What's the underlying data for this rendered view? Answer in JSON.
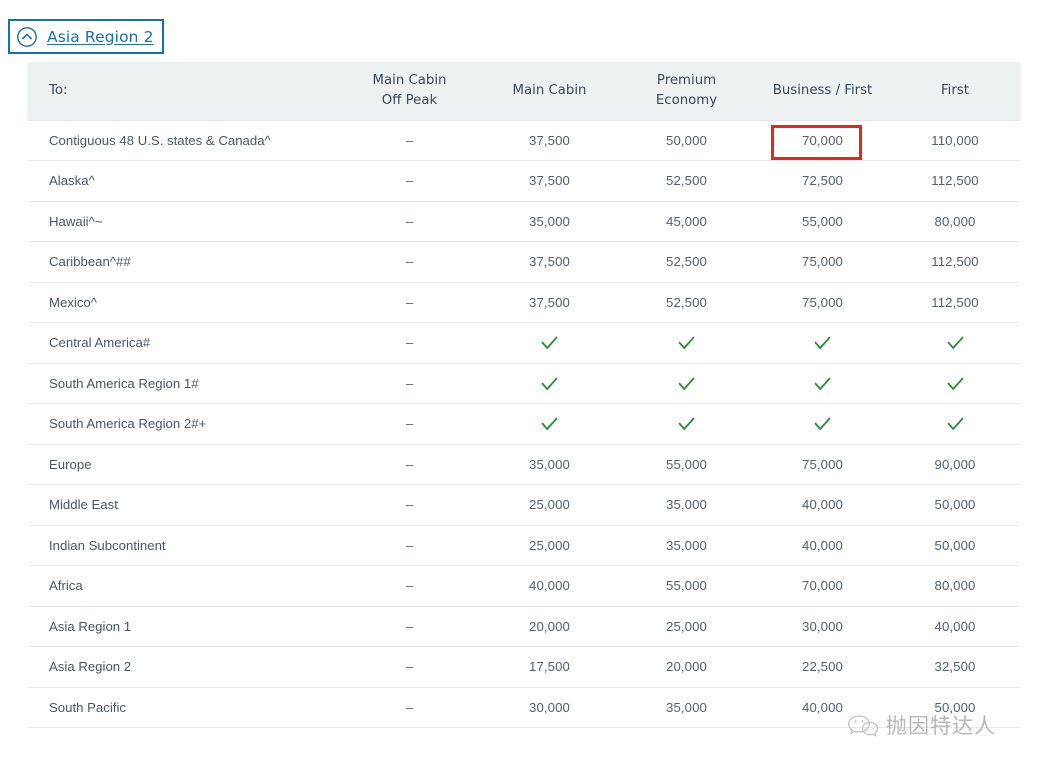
{
  "section": {
    "toggle_label": "Asia Region 2",
    "toggle_icon": "chevron-up-circle-icon",
    "focus_outline_color": "#1471ae",
    "link_color": "#1d6fa5"
  },
  "table": {
    "headers": {
      "region": "To:",
      "main_cabin_off_peak_line1": "Main Cabin",
      "main_cabin_off_peak_line2": "Off Peak",
      "main_cabin": "Main Cabin",
      "premium_economy_line1": "Premium",
      "premium_economy_line2": "Economy",
      "business_first": "Business / First",
      "first": "First"
    },
    "rows": [
      {
        "region": "Contiguous 48 U.S. states & Canada^",
        "main_cabin_off_peak": "–",
        "main_cabin": "37,500",
        "premium_economy": "50,000",
        "business_first": "70,000",
        "first": "110,000"
      },
      {
        "region": "Alaska^",
        "main_cabin_off_peak": "–",
        "main_cabin": "37,500",
        "premium_economy": "52,500",
        "business_first": "72,500",
        "first": "112,500"
      },
      {
        "region": "Hawaii^~",
        "main_cabin_off_peak": "–",
        "main_cabin": "35,000",
        "premium_economy": "45,000",
        "business_first": "55,000",
        "first": "80,000"
      },
      {
        "region": "Caribbean^##",
        "main_cabin_off_peak": "–",
        "main_cabin": "37,500",
        "premium_economy": "52,500",
        "business_first": "75,000",
        "first": "112,500"
      },
      {
        "region": "Mexico^",
        "main_cabin_off_peak": "–",
        "main_cabin": "37,500",
        "premium_economy": "52,500",
        "business_first": "75,000",
        "first": "112,500"
      },
      {
        "region": "Central America#",
        "main_cabin_off_peak": "–",
        "main_cabin": "check",
        "premium_economy": "check",
        "business_first": "check",
        "first": "check"
      },
      {
        "region": "South America Region 1#",
        "main_cabin_off_peak": "–",
        "main_cabin": "check",
        "premium_economy": "check",
        "business_first": "check",
        "first": "check"
      },
      {
        "region": "South America Region 2#+",
        "main_cabin_off_peak": "–",
        "main_cabin": "check",
        "premium_economy": "check",
        "business_first": "check",
        "first": "check"
      },
      {
        "region": "Europe",
        "main_cabin_off_peak": "–",
        "main_cabin": "35,000",
        "premium_economy": "55,000",
        "business_first": "75,000",
        "first": "90,000"
      },
      {
        "region": "Middle East",
        "main_cabin_off_peak": "–",
        "main_cabin": "25,000",
        "premium_economy": "35,000",
        "business_first": "40,000",
        "first": "50,000"
      },
      {
        "region": "Indian Subcontinent",
        "main_cabin_off_peak": "–",
        "main_cabin": "25,000",
        "premium_economy": "35,000",
        "business_first": "40,000",
        "first": "50,000"
      },
      {
        "region": "Africa",
        "main_cabin_off_peak": "–",
        "main_cabin": "40,000",
        "premium_economy": "55,000",
        "business_first": "70,000",
        "first": "80,000"
      },
      {
        "region": "Asia Region 1",
        "main_cabin_off_peak": "–",
        "main_cabin": "20,000",
        "premium_economy": "25,000",
        "business_first": "30,000",
        "first": "40,000"
      },
      {
        "region": "Asia Region 2",
        "main_cabin_off_peak": "–",
        "main_cabin": "17,500",
        "premium_economy": "20,000",
        "business_first": "22,500",
        "first": "32,500"
      },
      {
        "region": "South Pacific",
        "main_cabin_off_peak": "–",
        "main_cabin": "30,000",
        "premium_economy": "35,000",
        "business_first": "40,000",
        "first": "50,000"
      }
    ],
    "check_color": "#2e8b3c",
    "header_bg": "#eef1f1"
  },
  "annotation": {
    "highlight_cell_value": "70,000",
    "highlight_color": "#e8261b"
  },
  "watermark": {
    "text": "抛因特达人",
    "icon": "wechat-icon"
  }
}
